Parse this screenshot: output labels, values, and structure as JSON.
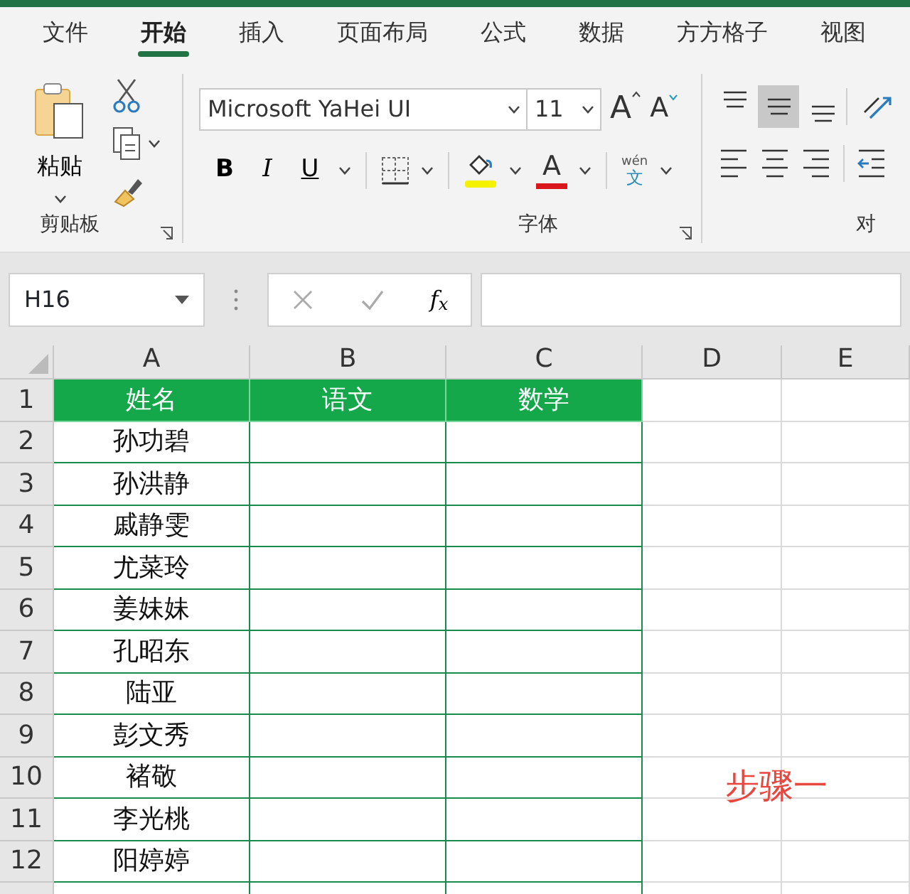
{
  "tabs": [
    {
      "label": "文件",
      "selected": false
    },
    {
      "label": "开始",
      "selected": true
    },
    {
      "label": "插入",
      "selected": false
    },
    {
      "label": "页面布局",
      "selected": false
    },
    {
      "label": "公式",
      "selected": false
    },
    {
      "label": "数据",
      "selected": false
    },
    {
      "label": "方方格子",
      "selected": false
    },
    {
      "label": "视图",
      "selected": false
    }
  ],
  "ribbon": {
    "clipboard": {
      "paste_label": "粘贴",
      "group_label": "剪贴板"
    },
    "font": {
      "font_name": "Microsoft YaHei UI",
      "font_size": "11",
      "grow_label": "A",
      "shrink_label": "A",
      "style_buttons": [
        {
          "label": "B",
          "kind": "bold"
        },
        {
          "label": "I",
          "kind": "italic"
        },
        {
          "label": "U",
          "kind": "underline"
        }
      ],
      "font_color_label": "A",
      "phonetic_top": "wén",
      "phonetic_bottom": "文",
      "group_label": "字体"
    },
    "alignment": {
      "group_label": "对",
      "vertical_align": [
        {
          "kind": "top",
          "selected": false
        },
        {
          "kind": "middle",
          "selected": true
        },
        {
          "kind": "bottom",
          "selected": false
        }
      ]
    }
  },
  "formula_bar": {
    "name_box": "H16",
    "function_label": "f$_{x}$"
  },
  "sheet": {
    "columns": [
      "A",
      "B",
      "C",
      "D",
      "E"
    ],
    "rows": [
      {
        "number": "1",
        "kind": "header",
        "cells": [
          "姓名",
          "语文",
          "数学"
        ]
      },
      {
        "number": "2",
        "kind": "data",
        "cells": [
          "孙功碧"
        ]
      },
      {
        "number": "3",
        "kind": "data",
        "cells": [
          "孙洪静"
        ]
      },
      {
        "number": "4",
        "kind": "data",
        "cells": [
          "戚静雯"
        ]
      },
      {
        "number": "5",
        "kind": "data",
        "cells": [
          "尤菜玲"
        ]
      },
      {
        "number": "6",
        "kind": "data",
        "cells": [
          "姜妹妹"
        ]
      },
      {
        "number": "7",
        "kind": "data",
        "cells": [
          "孔昭东"
        ]
      },
      {
        "number": "8",
        "kind": "data",
        "cells": [
          "陆亚"
        ]
      },
      {
        "number": "9",
        "kind": "data",
        "cells": [
          "彭文秀"
        ]
      },
      {
        "number": "10",
        "kind": "data",
        "cells": [
          "褚敬"
        ]
      },
      {
        "number": "11",
        "kind": "data",
        "cells": [
          "李光桃"
        ]
      },
      {
        "number": "12",
        "kind": "data",
        "cells": [
          "阳婷婷"
        ]
      }
    ],
    "annotation": "步骤一"
  }
}
